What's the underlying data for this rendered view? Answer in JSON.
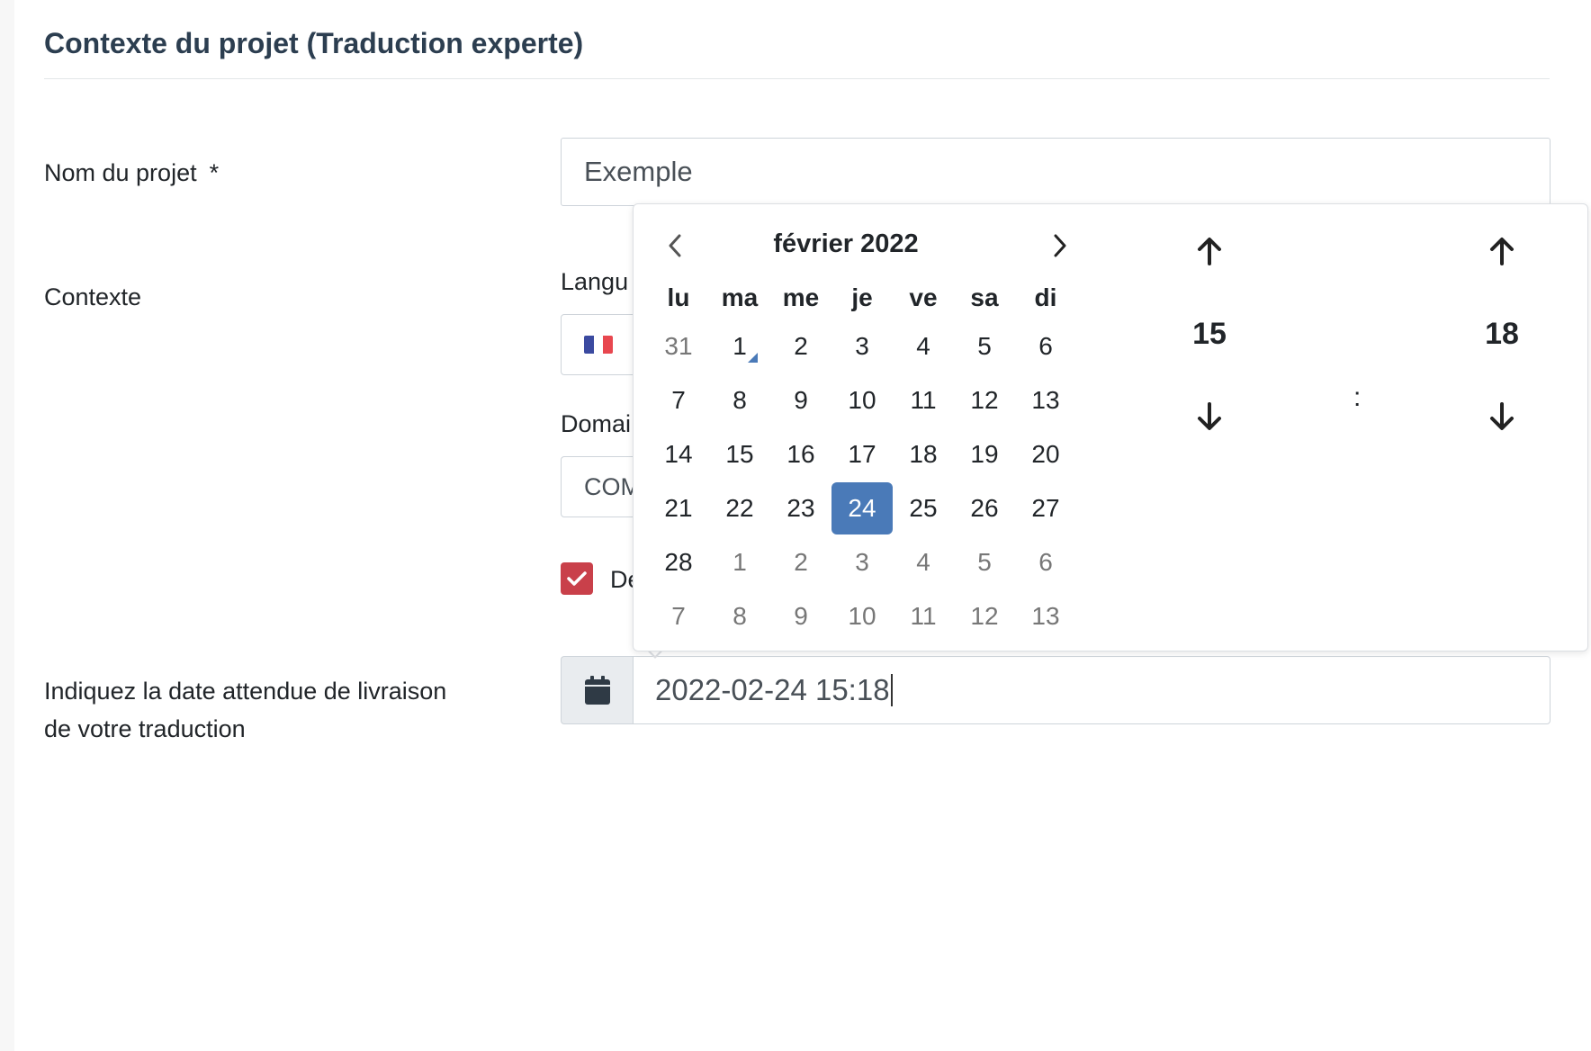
{
  "section": {
    "title": "Contexte du projet (Traduction experte)"
  },
  "project_name": {
    "label": "Nom du projet",
    "required_mark": "*",
    "value": "Exemple"
  },
  "context": {
    "label": "Contexte",
    "language_label": "Langu",
    "domain_label": "Domai",
    "domain_value": "COM",
    "checkbox_text": "De",
    "flag_colors": [
      "#3b4aa0",
      "#ffffff",
      "#e8474f"
    ]
  },
  "delivery": {
    "label_line1": "Indiquez la date attendue de livraison",
    "label_line2": "de votre traduction",
    "value": "2022-02-24 15:18"
  },
  "picker": {
    "month_title": "février 2022",
    "weekdays": [
      "lu",
      "ma",
      "me",
      "je",
      "ve",
      "sa",
      "di"
    ],
    "weeks": [
      [
        {
          "d": "31",
          "m": true
        },
        {
          "d": "1",
          "today": true
        },
        {
          "d": "2"
        },
        {
          "d": "3"
        },
        {
          "d": "4"
        },
        {
          "d": "5"
        },
        {
          "d": "6"
        }
      ],
      [
        {
          "d": "7"
        },
        {
          "d": "8"
        },
        {
          "d": "9"
        },
        {
          "d": "10"
        },
        {
          "d": "11"
        },
        {
          "d": "12"
        },
        {
          "d": "13"
        }
      ],
      [
        {
          "d": "14"
        },
        {
          "d": "15"
        },
        {
          "d": "16"
        },
        {
          "d": "17"
        },
        {
          "d": "18"
        },
        {
          "d": "19"
        },
        {
          "d": "20"
        }
      ],
      [
        {
          "d": "21"
        },
        {
          "d": "22"
        },
        {
          "d": "23"
        },
        {
          "d": "24",
          "sel": true
        },
        {
          "d": "25"
        },
        {
          "d": "26"
        },
        {
          "d": "27"
        }
      ],
      [
        {
          "d": "28"
        },
        {
          "d": "1",
          "m": true
        },
        {
          "d": "2",
          "m": true
        },
        {
          "d": "3",
          "m": true
        },
        {
          "d": "4",
          "m": true
        },
        {
          "d": "5",
          "m": true
        },
        {
          "d": "6",
          "m": true
        }
      ],
      [
        {
          "d": "7",
          "m": true
        },
        {
          "d": "8",
          "m": true
        },
        {
          "d": "9",
          "m": true
        },
        {
          "d": "10",
          "m": true
        },
        {
          "d": "11",
          "m": true
        },
        {
          "d": "12",
          "m": true
        },
        {
          "d": "13",
          "m": true
        }
      ]
    ],
    "hour": "15",
    "minute": "18",
    "separator": ":"
  },
  "colors": {
    "accent": "#4a7ab8",
    "checkbox": "#c9404a",
    "title": "#2c3e50"
  }
}
